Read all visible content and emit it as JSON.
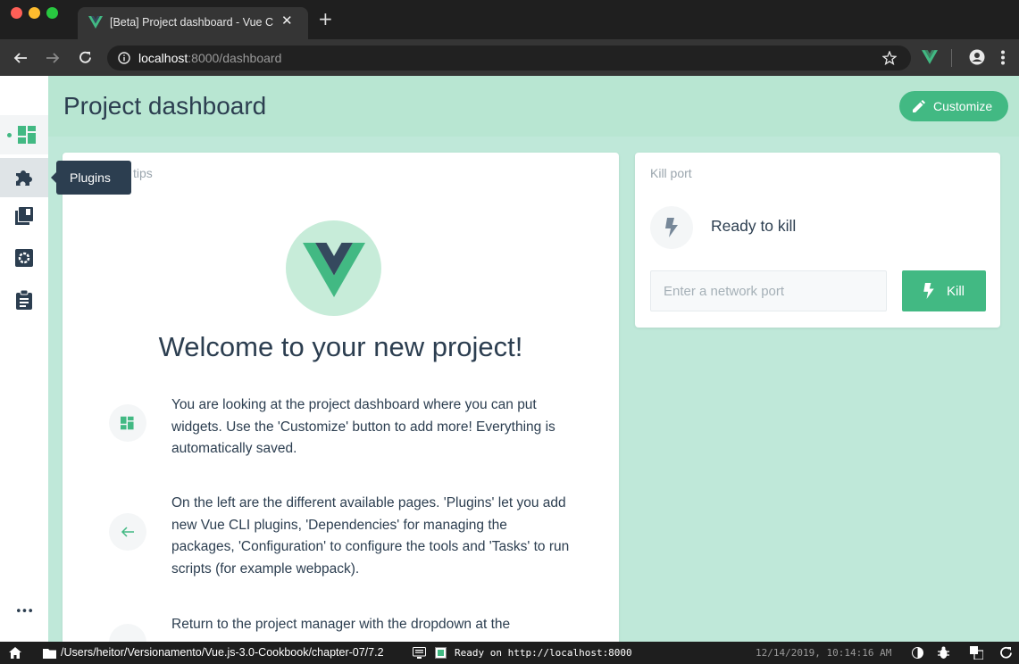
{
  "browser": {
    "tab_title": "[Beta] Project dashboard - Vue C",
    "tab_close": "✕",
    "new_tab": "+",
    "url_host": "localhost",
    "url_rest": ":8000/dashboard"
  },
  "header": {
    "title": "Project dashboard",
    "customize_label": "Customize"
  },
  "sidebar": {
    "tooltip": "Plugins",
    "more": "•••"
  },
  "welcome": {
    "card_title": "Welcome tips",
    "headline": "Welcome to your new project!",
    "tips": [
      "You are looking at the project dashboard where you can put widgets. Use the 'Customize' button to add more! Everything is automatically saved.",
      "On the left are the different available pages. 'Plugins' let you add new Vue CLI plugins, 'Dependencies' for managing the packages, 'Configuration' to configure the tools and 'Tasks' to run scripts (for example webpack).",
      "Return to the project manager with the dropdown at the"
    ]
  },
  "kill_port": {
    "card_title": "Kill port",
    "status": "Ready to kill",
    "input_placeholder": "Enter a network port",
    "button_label": "Kill"
  },
  "statusbar": {
    "path": "/Users/heitor/Versionamento/Vue.js-3.0-Cookbook/chapter-07/7.2",
    "log": "Ready on http://localhost:8000",
    "timestamp": "12/14/2019, 10:14:16 AM"
  },
  "colors": {
    "accent": "#42b983",
    "dark": "#2c3e50",
    "background": "#bfe8d9"
  }
}
